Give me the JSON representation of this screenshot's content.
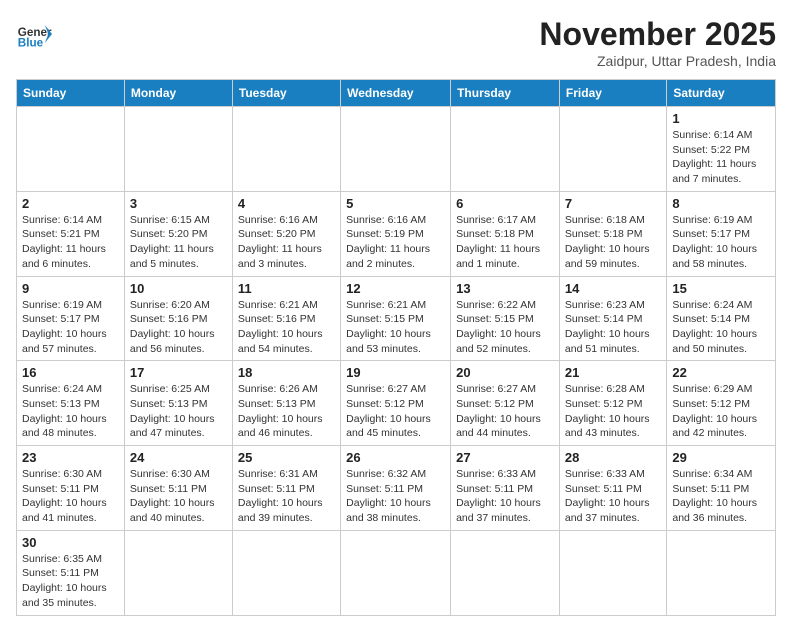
{
  "header": {
    "logo_general": "General",
    "logo_blue": "Blue",
    "month_title": "November 2025",
    "subtitle": "Zaidpur, Uttar Pradesh, India"
  },
  "weekdays": [
    "Sunday",
    "Monday",
    "Tuesday",
    "Wednesday",
    "Thursday",
    "Friday",
    "Saturday"
  ],
  "weeks": [
    [
      {
        "day": "",
        "info": ""
      },
      {
        "day": "",
        "info": ""
      },
      {
        "day": "",
        "info": ""
      },
      {
        "day": "",
        "info": ""
      },
      {
        "day": "",
        "info": ""
      },
      {
        "day": "",
        "info": ""
      },
      {
        "day": "1",
        "info": "Sunrise: 6:14 AM\nSunset: 5:22 PM\nDaylight: 11 hours\nand 7 minutes."
      }
    ],
    [
      {
        "day": "2",
        "info": "Sunrise: 6:14 AM\nSunset: 5:21 PM\nDaylight: 11 hours\nand 6 minutes."
      },
      {
        "day": "3",
        "info": "Sunrise: 6:15 AM\nSunset: 5:20 PM\nDaylight: 11 hours\nand 5 minutes."
      },
      {
        "day": "4",
        "info": "Sunrise: 6:16 AM\nSunset: 5:20 PM\nDaylight: 11 hours\nand 3 minutes."
      },
      {
        "day": "5",
        "info": "Sunrise: 6:16 AM\nSunset: 5:19 PM\nDaylight: 11 hours\nand 2 minutes."
      },
      {
        "day": "6",
        "info": "Sunrise: 6:17 AM\nSunset: 5:18 PM\nDaylight: 11 hours\nand 1 minute."
      },
      {
        "day": "7",
        "info": "Sunrise: 6:18 AM\nSunset: 5:18 PM\nDaylight: 10 hours\nand 59 minutes."
      },
      {
        "day": "8",
        "info": "Sunrise: 6:19 AM\nSunset: 5:17 PM\nDaylight: 10 hours\nand 58 minutes."
      }
    ],
    [
      {
        "day": "9",
        "info": "Sunrise: 6:19 AM\nSunset: 5:17 PM\nDaylight: 10 hours\nand 57 minutes."
      },
      {
        "day": "10",
        "info": "Sunrise: 6:20 AM\nSunset: 5:16 PM\nDaylight: 10 hours\nand 56 minutes."
      },
      {
        "day": "11",
        "info": "Sunrise: 6:21 AM\nSunset: 5:16 PM\nDaylight: 10 hours\nand 54 minutes."
      },
      {
        "day": "12",
        "info": "Sunrise: 6:21 AM\nSunset: 5:15 PM\nDaylight: 10 hours\nand 53 minutes."
      },
      {
        "day": "13",
        "info": "Sunrise: 6:22 AM\nSunset: 5:15 PM\nDaylight: 10 hours\nand 52 minutes."
      },
      {
        "day": "14",
        "info": "Sunrise: 6:23 AM\nSunset: 5:14 PM\nDaylight: 10 hours\nand 51 minutes."
      },
      {
        "day": "15",
        "info": "Sunrise: 6:24 AM\nSunset: 5:14 PM\nDaylight: 10 hours\nand 50 minutes."
      }
    ],
    [
      {
        "day": "16",
        "info": "Sunrise: 6:24 AM\nSunset: 5:13 PM\nDaylight: 10 hours\nand 48 minutes."
      },
      {
        "day": "17",
        "info": "Sunrise: 6:25 AM\nSunset: 5:13 PM\nDaylight: 10 hours\nand 47 minutes."
      },
      {
        "day": "18",
        "info": "Sunrise: 6:26 AM\nSunset: 5:13 PM\nDaylight: 10 hours\nand 46 minutes."
      },
      {
        "day": "19",
        "info": "Sunrise: 6:27 AM\nSunset: 5:12 PM\nDaylight: 10 hours\nand 45 minutes."
      },
      {
        "day": "20",
        "info": "Sunrise: 6:27 AM\nSunset: 5:12 PM\nDaylight: 10 hours\nand 44 minutes."
      },
      {
        "day": "21",
        "info": "Sunrise: 6:28 AM\nSunset: 5:12 PM\nDaylight: 10 hours\nand 43 minutes."
      },
      {
        "day": "22",
        "info": "Sunrise: 6:29 AM\nSunset: 5:12 PM\nDaylight: 10 hours\nand 42 minutes."
      }
    ],
    [
      {
        "day": "23",
        "info": "Sunrise: 6:30 AM\nSunset: 5:11 PM\nDaylight: 10 hours\nand 41 minutes."
      },
      {
        "day": "24",
        "info": "Sunrise: 6:30 AM\nSunset: 5:11 PM\nDaylight: 10 hours\nand 40 minutes."
      },
      {
        "day": "25",
        "info": "Sunrise: 6:31 AM\nSunset: 5:11 PM\nDaylight: 10 hours\nand 39 minutes."
      },
      {
        "day": "26",
        "info": "Sunrise: 6:32 AM\nSunset: 5:11 PM\nDaylight: 10 hours\nand 38 minutes."
      },
      {
        "day": "27",
        "info": "Sunrise: 6:33 AM\nSunset: 5:11 PM\nDaylight: 10 hours\nand 37 minutes."
      },
      {
        "day": "28",
        "info": "Sunrise: 6:33 AM\nSunset: 5:11 PM\nDaylight: 10 hours\nand 37 minutes."
      },
      {
        "day": "29",
        "info": "Sunrise: 6:34 AM\nSunset: 5:11 PM\nDaylight: 10 hours\nand 36 minutes."
      }
    ],
    [
      {
        "day": "30",
        "info": "Sunrise: 6:35 AM\nSunset: 5:11 PM\nDaylight: 10 hours\nand 35 minutes."
      },
      {
        "day": "",
        "info": ""
      },
      {
        "day": "",
        "info": ""
      },
      {
        "day": "",
        "info": ""
      },
      {
        "day": "",
        "info": ""
      },
      {
        "day": "",
        "info": ""
      },
      {
        "day": "",
        "info": ""
      }
    ]
  ]
}
